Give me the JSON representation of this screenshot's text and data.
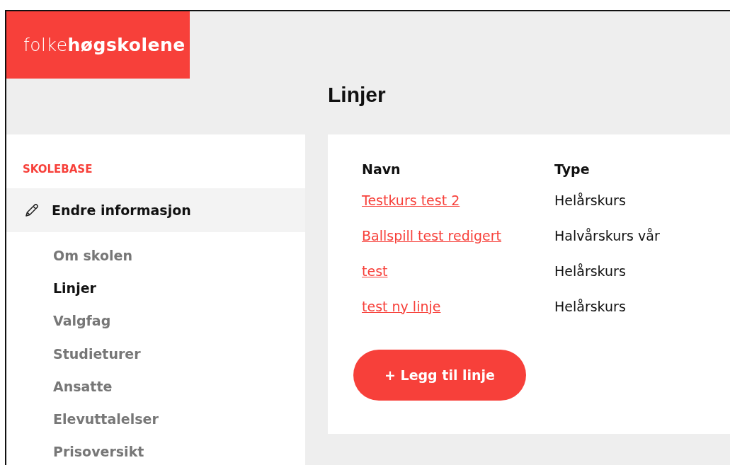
{
  "logo": "folke**høgskolene**",
  "page_title": "Linjer",
  "sidebar": {
    "section": "SKOLEBASE",
    "group": {
      "label": "Endre informasjon",
      "expanded": true
    },
    "items": [
      {
        "label": "Om skolen",
        "selected": false
      },
      {
        "label": "Linjer",
        "selected": true
      },
      {
        "label": "Valgfag",
        "selected": false
      },
      {
        "label": "Studieturer",
        "selected": false
      },
      {
        "label": "Ansatte",
        "selected": false
      },
      {
        "label": "Elevuttalelser",
        "selected": false
      },
      {
        "label": "Prisoversikt",
        "selected": false
      }
    ]
  },
  "table": {
    "columns": [
      "Navn",
      "Type"
    ],
    "rows": [
      {
        "name": "Testkurs test 2",
        "type": "Helårskurs"
      },
      {
        "name": "Ballspill test redigert",
        "type": "Halvårskurs vår"
      },
      {
        "name": "test",
        "type": "Helårskurs"
      },
      {
        "name": "test ny linje",
        "type": "Helårskurs"
      }
    ]
  },
  "add_button": "+ Legg til linje"
}
